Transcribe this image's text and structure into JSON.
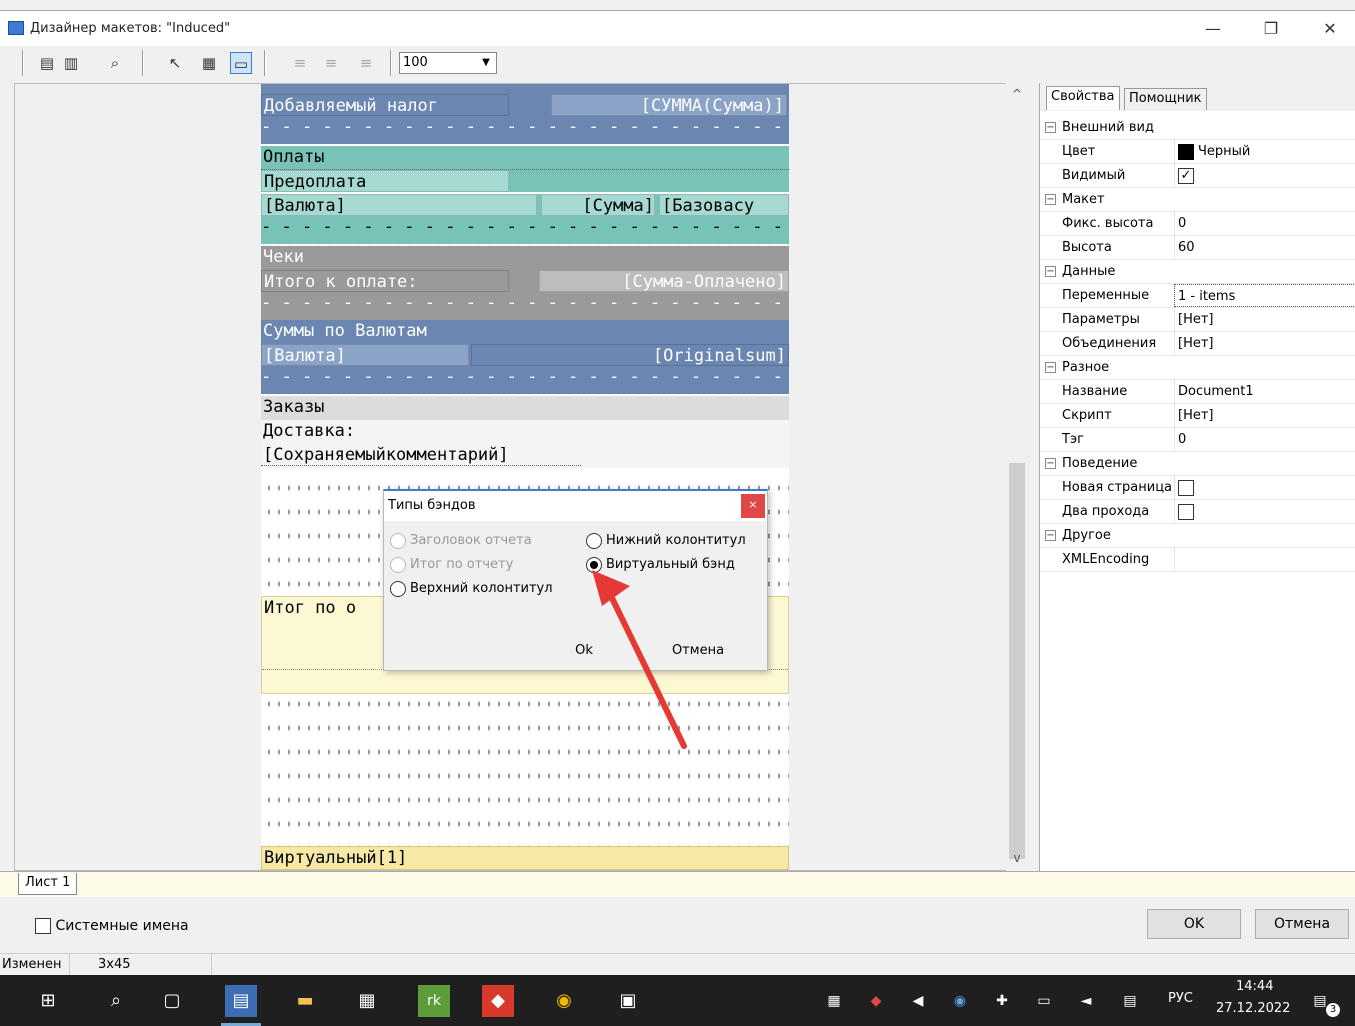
{
  "window": {
    "title": "Дизайнер макетов: \"Induced\"",
    "minimize": "—",
    "maximize": "❐",
    "close": "✕"
  },
  "toolbar": {
    "zoom": "100"
  },
  "report": {
    "rows": [
      {
        "text": "Добавляемый налог"
      },
      {
        "text": "[СУММА(Сумма)]"
      },
      {
        "text": "Оплаты"
      },
      {
        "text": "Предоплата"
      },
      {
        "text": "[Валюта]"
      },
      {
        "text": "[Сумма]"
      },
      {
        "text": "[Базовасу"
      },
      {
        "text": "Чеки"
      },
      {
        "text": "Итого к оплате:"
      },
      {
        "text": "[Сумма-Оплачено]"
      },
      {
        "text": "Суммы по Валютам"
      },
      {
        "text": "[Валюта]"
      },
      {
        "text": "[Originalsum]"
      },
      {
        "text": "Заказы"
      },
      {
        "text": "Доставка:"
      },
      {
        "text": "[Сохраняемыйкомментарий]"
      },
      {
        "text": "Итог по о"
      },
      {
        "text": "Виртуальный[1]"
      }
    ]
  },
  "dialog": {
    "title": "Типы бэндов",
    "close": "×",
    "options": {
      "report_header": "Заголовок отчета",
      "report_total": "Итог по отчету",
      "page_header": "Верхний колонтитул",
      "page_footer": "Нижний колонтитул",
      "virtual_band": "Виртуальный бэнд"
    },
    "ok": "Ok",
    "cancel": "Отмена"
  },
  "props": {
    "tabs": [
      "Свойства",
      "Помощник"
    ],
    "rows": [
      {
        "k": "Внешний вид",
        "v": ""
      },
      {
        "k": "Цвет",
        "v": "Черный"
      },
      {
        "k": "Видимый",
        "v": "✓"
      },
      {
        "k": "Макет",
        "v": ""
      },
      {
        "k": "Фикс. высота",
        "v": "0"
      },
      {
        "k": "Высота",
        "v": "60"
      },
      {
        "k": "Данные",
        "v": ""
      },
      {
        "k": "Переменные",
        "v": "1 - items"
      },
      {
        "k": "Параметры",
        "v": "[Нет]"
      },
      {
        "k": "Объединения",
        "v": "[Нет]"
      },
      {
        "k": "Разное",
        "v": ""
      },
      {
        "k": "Название",
        "v": "Document1"
      },
      {
        "k": "Скрипт",
        "v": "[Нет]"
      },
      {
        "k": "Тэг",
        "v": "0"
      },
      {
        "k": "Поведение",
        "v": ""
      },
      {
        "k": "Новая страница",
        "v": ""
      },
      {
        "k": "Два прохода",
        "v": ""
      },
      {
        "k": "Другое",
        "v": ""
      },
      {
        "k": "XMLEncoding",
        "v": ""
      }
    ]
  },
  "sheet_tab": "Лист 1",
  "footer": {
    "system_names": "Системные имена",
    "ok": "OK",
    "cancel": "Отмена"
  },
  "status": {
    "state": "Изменен",
    "size": "3x45"
  },
  "taskbar": {
    "lang": "РУС",
    "time": "14:44",
    "date": "27.12.2022",
    "notifications": "3"
  },
  "colors": {
    "accent": "#3a7bd5",
    "arrow": "#e53935"
  }
}
